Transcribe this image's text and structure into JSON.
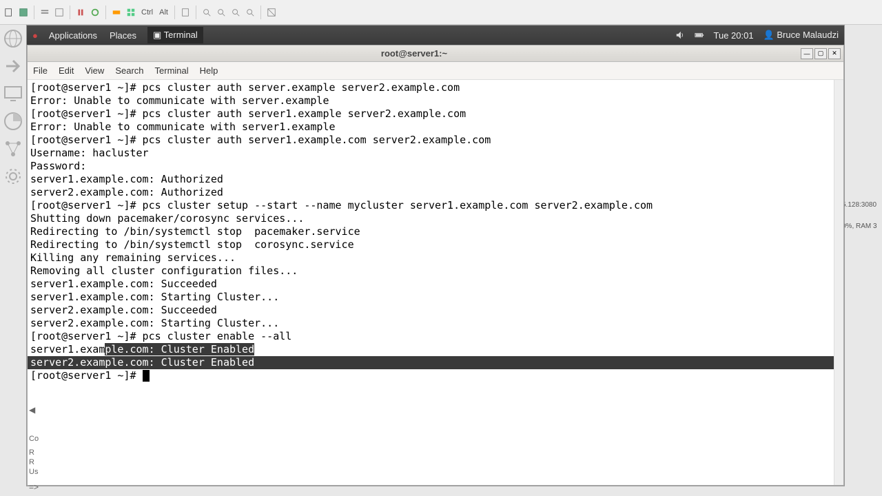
{
  "toolbar": {
    "ctrl": "Ctrl",
    "alt": "Alt"
  },
  "panel": {
    "applications": "Applications",
    "places": "Places",
    "terminal_tab": "Terminal",
    "time": "Tue 20:01",
    "user": "Bruce Malaudzi"
  },
  "terminal": {
    "title": "root@server1:~",
    "menu": {
      "file": "File",
      "edit": "Edit",
      "view": "View",
      "search": "Search",
      "terminal": "Terminal",
      "help": "Help"
    },
    "lines": [
      "[root@server1 ~]# pcs cluster auth server.example server2.example.com",
      "Error: Unable to communicate with server.example",
      "[root@server1 ~]# pcs cluster auth server1.example server2.example.com",
      "Error: Unable to communicate with server1.example",
      "[root@server1 ~]# pcs cluster auth server1.example.com server2.example.com",
      "Username: hacluster",
      "Password: ",
      "server1.example.com: Authorized",
      "server2.example.com: Authorized",
      "[root@server1 ~]# pcs cluster setup --start --name mycluster server1.example.com server2.example.com",
      "Shutting down pacemaker/corosync services...",
      "Redirecting to /bin/systemctl stop  pacemaker.service",
      "Redirecting to /bin/systemctl stop  corosync.service",
      "Killing any remaining services...",
      "Removing all cluster configuration files...",
      "server1.example.com: Succeeded",
      "server1.example.com: Starting Cluster...",
      "server2.example.com: Succeeded",
      "server2.example.com: Starting Cluster...",
      "[root@server1 ~]# pcs cluster enable --all"
    ],
    "hl_line_partial_pre": "server1.exam",
    "hl_line_partial_post": "ple.com: Cluster Enabled",
    "hl_line2": "server2.example.com: Cluster Enabled",
    "prompt_final": "[root@server1 ~]# "
  },
  "right_peek": {
    "ip": "5.128:3080",
    "stats": "0%, RAM 3"
  },
  "bottom": {
    "co": "Co",
    "r": "R",
    "r2": "R",
    "us": "Us",
    "prompt": "=>"
  }
}
